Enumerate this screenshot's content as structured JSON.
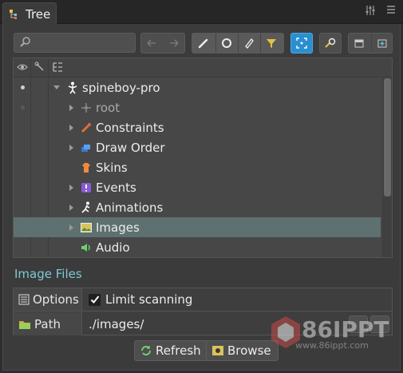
{
  "window": {
    "tab_title": "Tree"
  },
  "search": {
    "placeholder": ""
  },
  "tree": {
    "rows": [
      {
        "label": "spineboy-pro",
        "icon": "skeleton-icon",
        "expander": "open",
        "visible_dot": true
      },
      {
        "label": "root",
        "icon": "bone-icon",
        "expander": "closed",
        "dim": true,
        "visible_dot": false
      },
      {
        "label": "Constraints",
        "icon": "constraints-icon",
        "expander": "closed"
      },
      {
        "label": "Draw Order",
        "icon": "draw-order-icon",
        "expander": "closed"
      },
      {
        "label": "Skins",
        "icon": "skins-icon",
        "expander": "none"
      },
      {
        "label": "Events",
        "icon": "events-icon",
        "expander": "closed"
      },
      {
        "label": "Animations",
        "icon": "animations-icon",
        "expander": "closed"
      },
      {
        "label": "Images",
        "icon": "images-icon",
        "expander": "closed",
        "selected": true
      },
      {
        "label": "Audio",
        "icon": "audio-icon",
        "expander": "none"
      }
    ]
  },
  "section": {
    "title": "Image Files",
    "options_label": "Options",
    "limit_scanning_label": "Limit scanning",
    "limit_scanning_checked": true,
    "path_label": "Path",
    "path_value": "./images/"
  },
  "buttons": {
    "refresh": "Refresh",
    "browse": "Browse"
  },
  "watermark": {
    "main": "86IPPT",
    "sub": "www.86ippt.com"
  },
  "colors": {
    "accent": "#7ec8d6",
    "selection": "#5e7070",
    "active_tool": "#2a8fd0"
  }
}
